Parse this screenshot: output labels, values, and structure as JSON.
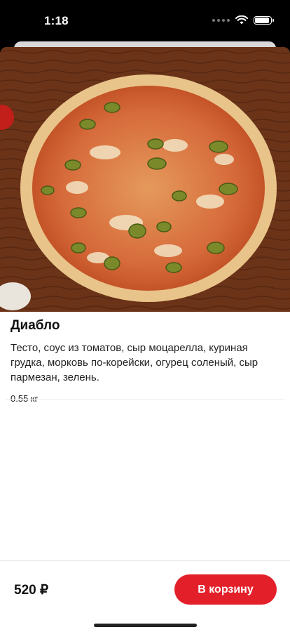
{
  "status_bar": {
    "time": "1:18",
    "battery_level": 1.0
  },
  "product": {
    "title": "Диабло",
    "description": "Тесто, соус из томатов, сыр моцарелла, куриная грудка, морковь по-корейски, огурец соленый, сыр пармезан, зелень.",
    "weight": "0.55 кг",
    "image": "pizza-photo"
  },
  "footer": {
    "price": "520 ₽",
    "cart_label": "В корзину"
  },
  "colors": {
    "accent": "#e3202a"
  }
}
